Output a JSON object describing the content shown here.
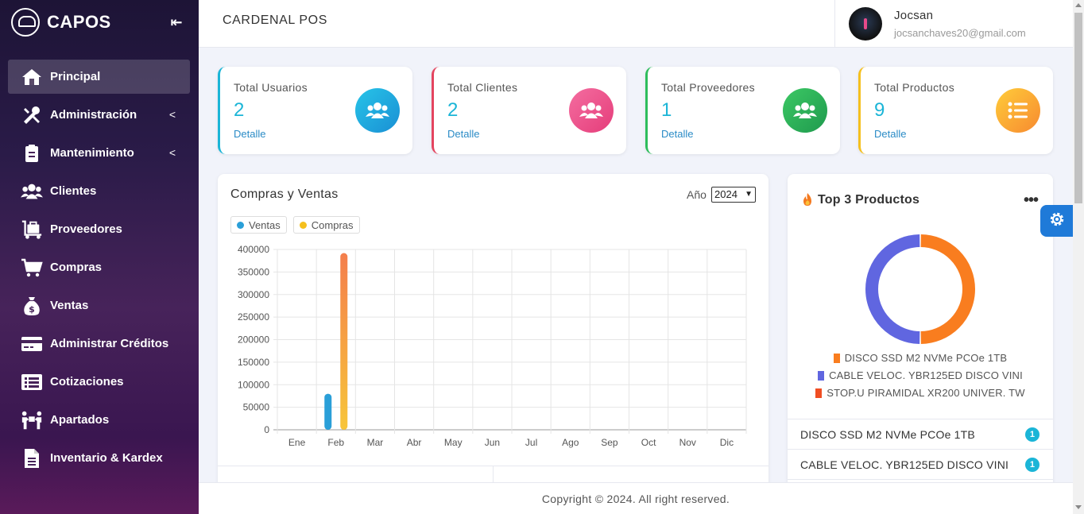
{
  "brand": {
    "name": "CAPOS"
  },
  "sidebar": {
    "items": [
      {
        "label": "Principal",
        "icon": "home-icon",
        "active": true,
        "has_submenu": false
      },
      {
        "label": "Administración",
        "icon": "tools-icon",
        "active": false,
        "has_submenu": true
      },
      {
        "label": "Mantenimiento",
        "icon": "clipboard-icon",
        "active": false,
        "has_submenu": true
      },
      {
        "label": "Clientes",
        "icon": "users-icon",
        "active": false,
        "has_submenu": false
      },
      {
        "label": "Proveedores",
        "icon": "luggage-cart-icon",
        "active": false,
        "has_submenu": false
      },
      {
        "label": "Compras",
        "icon": "shopping-cart-icon",
        "active": false,
        "has_submenu": false
      },
      {
        "label": "Ventas",
        "icon": "money-bag-icon",
        "active": false,
        "has_submenu": false
      },
      {
        "label": "Administrar Créditos",
        "icon": "credit-card-icon",
        "active": false,
        "has_submenu": false
      },
      {
        "label": "Cotizaciones",
        "icon": "list-alt-icon",
        "active": false,
        "has_submenu": false
      },
      {
        "label": "Apartados",
        "icon": "people-carry-icon",
        "active": false,
        "has_submenu": false
      },
      {
        "label": "Inventario & Kardex",
        "icon": "file-icon",
        "active": false,
        "has_submenu": false
      }
    ]
  },
  "header": {
    "title": "CARDENAL POS",
    "user": {
      "name": "Jocsan",
      "email": "jocsanchaves20@gmail.com"
    }
  },
  "stats": [
    {
      "label": "Total Usuarios",
      "value": "2",
      "link": "Detalle",
      "color": "#1bb5d7",
      "icon": "users-icon"
    },
    {
      "label": "Total Clientes",
      "value": "2",
      "link": "Detalle",
      "color": "#e4445f",
      "icon": "users-icon"
    },
    {
      "label": "Total Proveedores",
      "value": "1",
      "link": "Detalle",
      "color": "#2ebd5c",
      "icon": "users-icon"
    },
    {
      "label": "Total Productos",
      "value": "9",
      "link": "Detalle",
      "color": "#f5c01e",
      "icon": "list-icon"
    }
  ],
  "sales_chart": {
    "title": "Compras y Ventas",
    "year_label": "Año",
    "year_selected": "2024"
  },
  "chart_data": {
    "type": "bar",
    "categories": [
      "Ene",
      "Feb",
      "Mar",
      "Abr",
      "May",
      "Jun",
      "Jul",
      "Ago",
      "Sep",
      "Oct",
      "Nov",
      "Dic"
    ],
    "series": [
      {
        "name": "Ventas",
        "color": "#2a9fd8",
        "values": [
          0,
          80000,
          0,
          0,
          0,
          0,
          0,
          0,
          0,
          0,
          0,
          0
        ]
      },
      {
        "name": "Compras",
        "color": "#f5b82e",
        "values": [
          0,
          392000,
          0,
          0,
          0,
          0,
          0,
          0,
          0,
          0,
          0,
          0
        ]
      }
    ],
    "y_ticks": [
      "0",
      "50000",
      "100000",
      "150000",
      "200000",
      "250000",
      "300000",
      "350000",
      "400000"
    ],
    "ylim": [
      0,
      400000
    ],
    "grid": true,
    "legend": "top-left"
  },
  "top_products": {
    "title": "Top 3 Productos",
    "donut": [
      {
        "name": "DISCO SSD M2 NVMe PCOe 1TB",
        "value": 1,
        "color": "#f97d1f"
      },
      {
        "name": "CABLE VELOC. YBR125ED DISCO VINI",
        "value": 1,
        "color": "#6066e0"
      },
      {
        "name": "STOP.U PIRAMIDAL XR200 UNIVER. TW",
        "value": 0,
        "color": "#f04e23"
      }
    ],
    "list": [
      {
        "name": "DISCO SSD M2 NVMe PCOe 1TB",
        "count": "1"
      },
      {
        "name": "CABLE VELOC. YBR125ED DISCO VINI",
        "count": "1"
      }
    ]
  },
  "footer": {
    "text": "Copyright © 2024. All right reserved."
  }
}
